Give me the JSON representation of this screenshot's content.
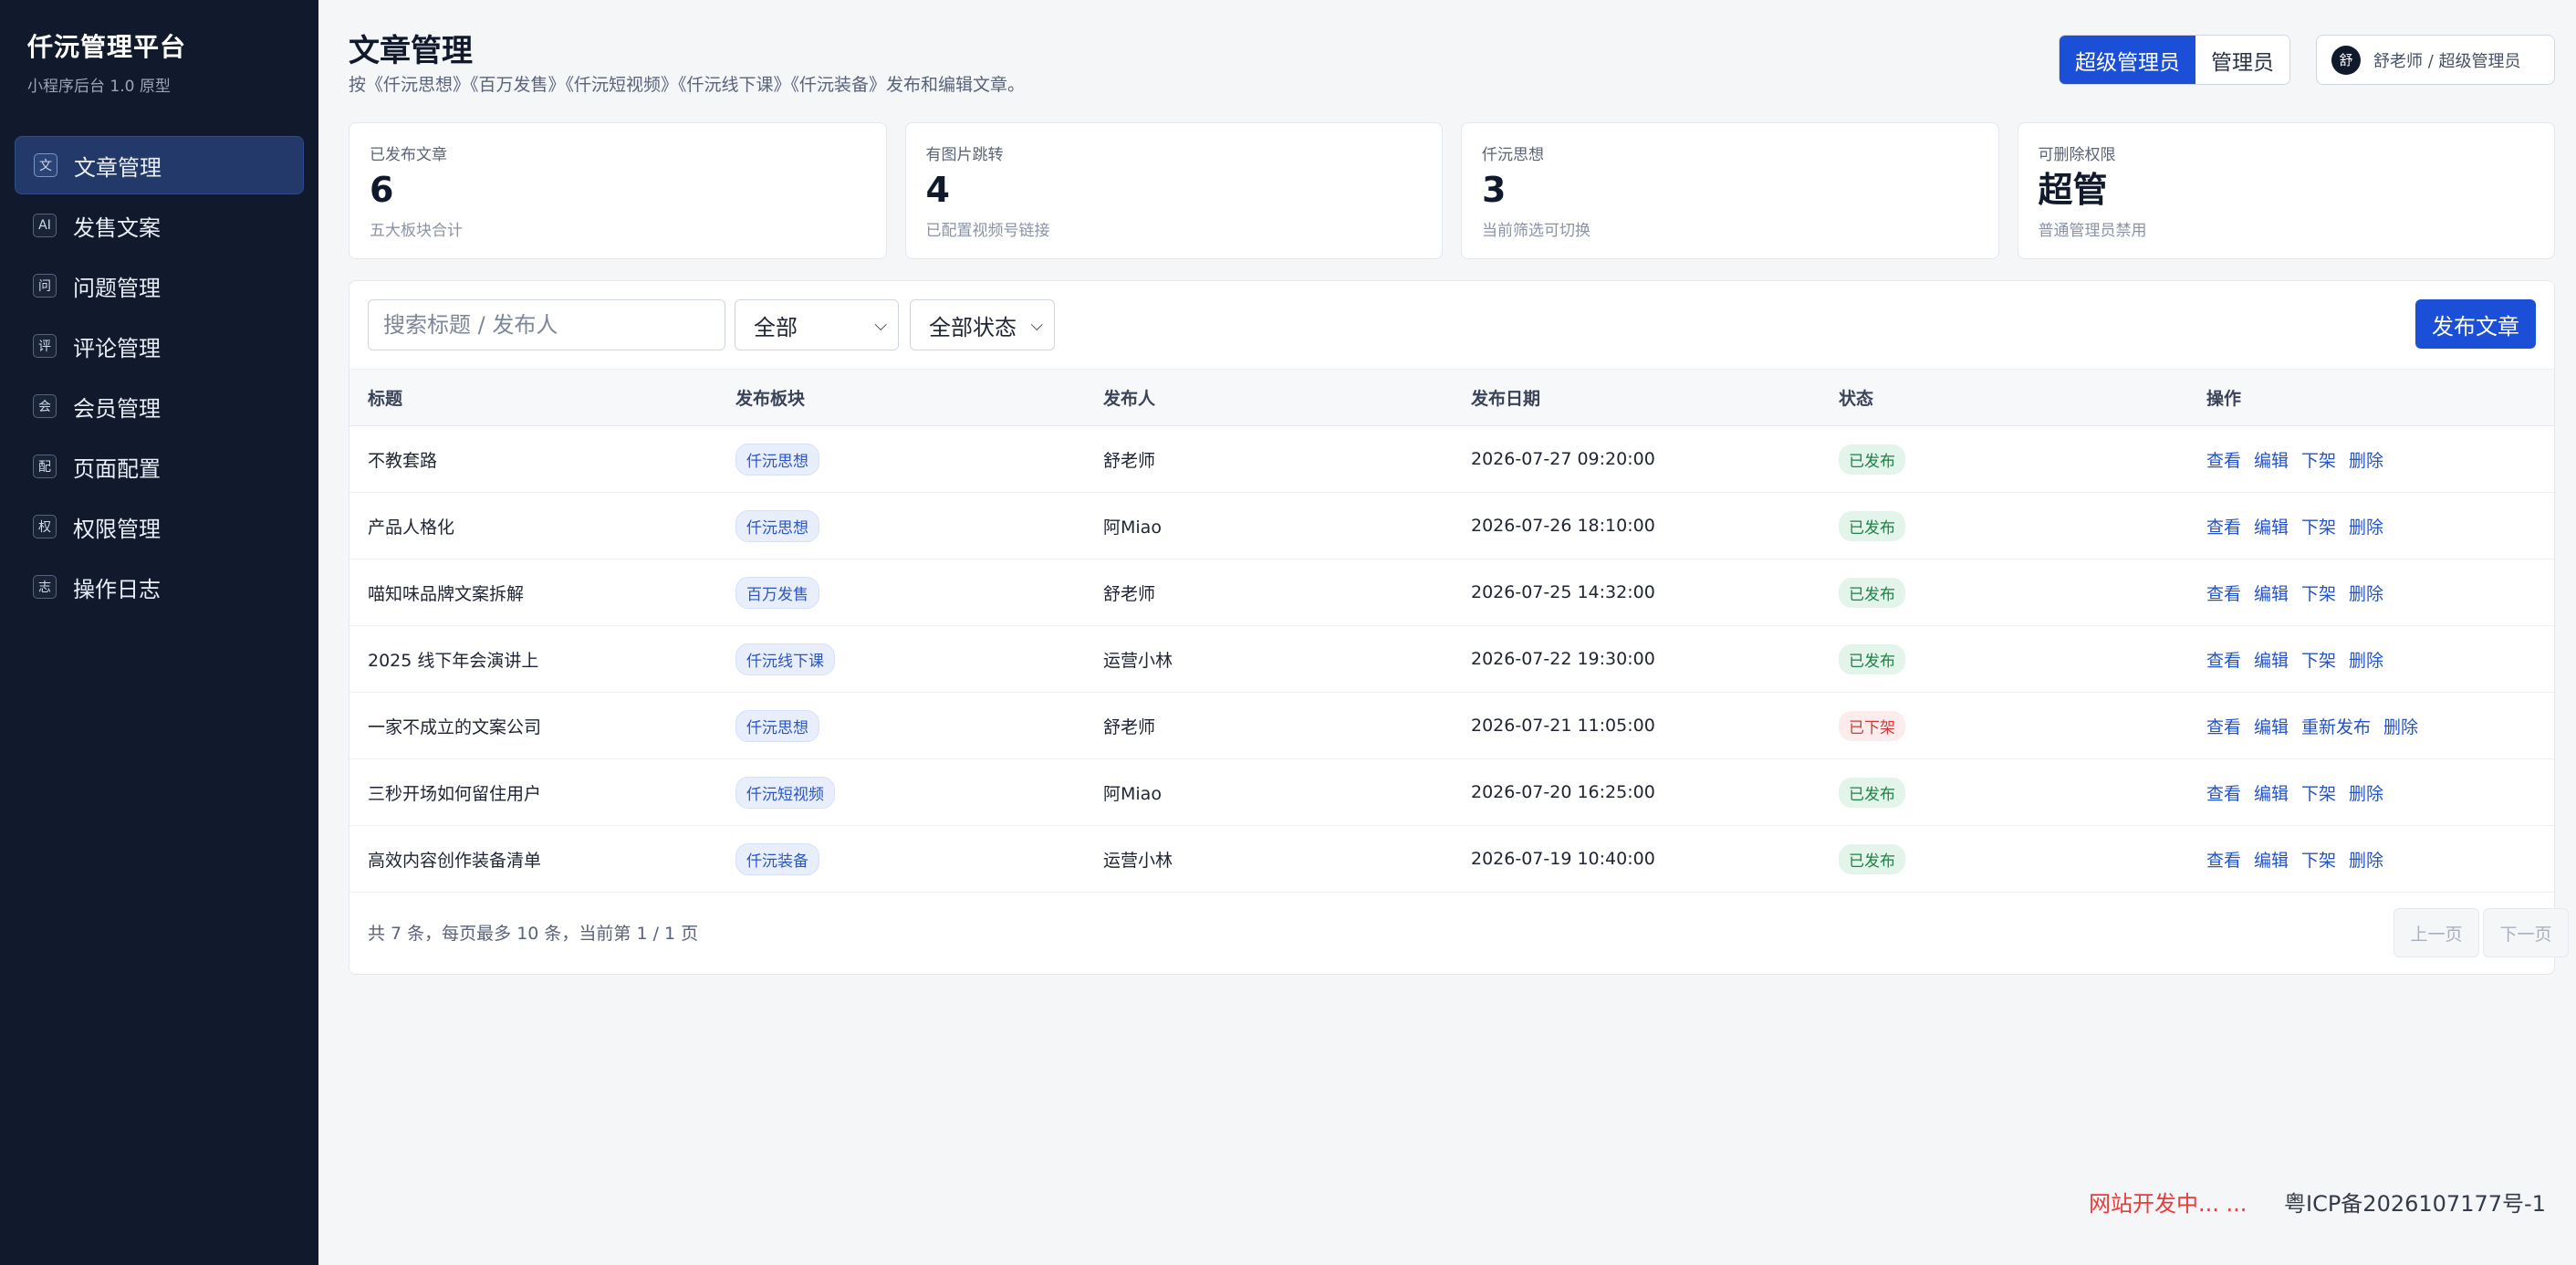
{
  "sidebar": {
    "title": "仟沅管理平台",
    "subtitle": "小程序后台 1.0 原型",
    "items": [
      {
        "icon": "文",
        "label": "文章管理",
        "active": true
      },
      {
        "icon": "AI",
        "label": "发售文案"
      },
      {
        "icon": "问",
        "label": "问题管理"
      },
      {
        "icon": "评",
        "label": "评论管理"
      },
      {
        "icon": "会",
        "label": "会员管理"
      },
      {
        "icon": "配",
        "label": "页面配置"
      },
      {
        "icon": "权",
        "label": "权限管理"
      },
      {
        "icon": "志",
        "label": "操作日志"
      }
    ]
  },
  "header": {
    "title": "文章管理",
    "description": "按《仟沅思想》《百万发售》《仟沅短视频》《仟沅线下课》《仟沅装备》发布和编辑文章。",
    "roles": [
      {
        "label": "超级管理员",
        "active": true
      },
      {
        "label": "管理员",
        "active": false
      }
    ],
    "user": {
      "avatar": "舒",
      "text": "舒老师 / 超级管理员"
    }
  },
  "stats": [
    {
      "label": "已发布文章",
      "value": "6",
      "hint": "五大板块合计"
    },
    {
      "label": "有图片跳转",
      "value": "4",
      "hint": "已配置视频号链接"
    },
    {
      "label": "仟沅思想",
      "value": "3",
      "hint": "当前筛选可切换"
    },
    {
      "label": "可删除权限",
      "value": "超管",
      "hint": "普通管理员禁用"
    }
  ],
  "toolbar": {
    "search_placeholder": "搜索标题 / 发布人",
    "section_filter": "全部",
    "status_filter": "全部状态",
    "publish_label": "发布文章"
  },
  "table": {
    "headers": [
      "标题",
      "发布板块",
      "发布人",
      "发布日期",
      "状态",
      "操作"
    ],
    "rows": [
      {
        "title": "不教套路",
        "section": "仟沅思想",
        "author": "舒老师",
        "date": "2026-07-27 09:20:00",
        "status": "已发布",
        "actions": [
          "查看",
          "编辑",
          "下架",
          "删除"
        ]
      },
      {
        "title": "产品人格化",
        "section": "仟沅思想",
        "author": "阿Miao",
        "date": "2026-07-26 18:10:00",
        "status": "已发布",
        "actions": [
          "查看",
          "编辑",
          "下架",
          "删除"
        ]
      },
      {
        "title": "喵知味品牌文案拆解",
        "section": "百万发售",
        "author": "舒老师",
        "date": "2026-07-25 14:32:00",
        "status": "已发布",
        "actions": [
          "查看",
          "编辑",
          "下架",
          "删除"
        ]
      },
      {
        "title": "2025 线下年会演讲上",
        "section": "仟沅线下课",
        "author": "运营小林",
        "date": "2026-07-22 19:30:00",
        "status": "已发布",
        "actions": [
          "查看",
          "编辑",
          "下架",
          "删除"
        ]
      },
      {
        "title": "一家不成立的文案公司",
        "section": "仟沅思想",
        "author": "舒老师",
        "date": "2026-07-21 11:05:00",
        "status": "已下架",
        "actions": [
          "查看",
          "编辑",
          "重新发布",
          "删除"
        ]
      },
      {
        "title": "三秒开场如何留住用户",
        "section": "仟沅短视频",
        "author": "阿Miao",
        "date": "2026-07-20 16:25:00",
        "status": "已发布",
        "actions": [
          "查看",
          "编辑",
          "下架",
          "删除"
        ]
      },
      {
        "title": "高效内容创作装备清单",
        "section": "仟沅装备",
        "author": "运营小林",
        "date": "2026-07-19 10:40:00",
        "status": "已发布",
        "actions": [
          "查看",
          "编辑",
          "下架",
          "删除"
        ]
      }
    ]
  },
  "pagination": {
    "info": "共 7 条，每页最多 10 条，当前第 1 / 1 页",
    "prev": "上一页",
    "next": "下一页"
  },
  "footer": {
    "dev_note": "网站开发中... ...",
    "icp": "粤ICP备2026107177号-1"
  },
  "colors": {
    "sidebar_bg": "#111a2c",
    "accent": "#1c4fd8",
    "published": "#208047",
    "unpublished": "#d23a3a"
  }
}
